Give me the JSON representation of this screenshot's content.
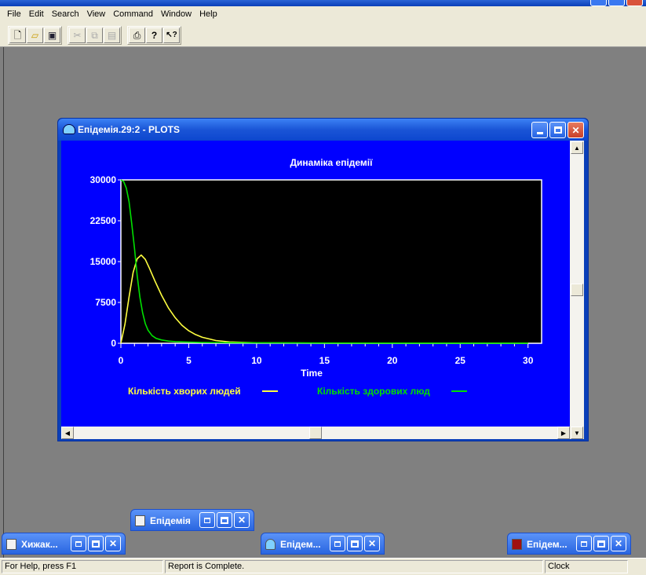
{
  "menubar": {
    "items": [
      "File",
      "Edit",
      "Search",
      "View",
      "Command",
      "Window",
      "Help"
    ]
  },
  "toolbar": {
    "buttons": [
      {
        "name": "new-file-icon",
        "glyph": "🗋"
      },
      {
        "name": "open-folder-icon",
        "glyph": "📂"
      },
      {
        "name": "save-icon",
        "glyph": "💾"
      },
      {
        "name": "cut-icon",
        "glyph": "✂"
      },
      {
        "name": "copy-icon",
        "glyph": "⧉"
      },
      {
        "name": "paste-icon",
        "glyph": "📋"
      },
      {
        "name": "print-icon",
        "glyph": "🖶"
      },
      {
        "name": "help-icon",
        "glyph": "?"
      },
      {
        "name": "context-help-icon",
        "glyph": "↖?"
      }
    ]
  },
  "plot_window": {
    "title": "Епідемія.29:2  -  PLOTS"
  },
  "chart_data": {
    "type": "line",
    "title": "Динаміка епідемії",
    "xlabel": "Time",
    "ylabel": "",
    "xlim": [
      0,
      31
    ],
    "ylim": [
      0,
      30000
    ],
    "xticks": [
      0,
      5,
      10,
      15,
      20,
      25,
      30
    ],
    "yticks": [
      0,
      7500,
      15000,
      22500,
      30000
    ],
    "ytick_labels": [
      "0",
      "7500",
      "15000",
      "22500",
      "30000"
    ],
    "xtick_labels": [
      "0",
      "5",
      "10",
      "15",
      "20",
      "25",
      "30"
    ],
    "legend_placement": "bottom",
    "series": [
      {
        "name": "Кількість хворих людей",
        "color": "#ffff40",
        "x": [
          0,
          0.3,
          0.6,
          0.9,
          1.2,
          1.5,
          1.8,
          2.1,
          2.5,
          3,
          3.5,
          4,
          4.5,
          5,
          5.5,
          6,
          7,
          8,
          10,
          15,
          20,
          25,
          30
        ],
        "y": [
          0,
          3500,
          8500,
          13000,
          15500,
          16200,
          15400,
          13800,
          11500,
          8800,
          6500,
          4700,
          3300,
          2300,
          1600,
          1100,
          500,
          250,
          80,
          10,
          0,
          0,
          0
        ]
      },
      {
        "name": "Кількість здорових люд",
        "color": "#00e000",
        "x": [
          0,
          0.2,
          0.4,
          0.6,
          0.8,
          1.0,
          1.2,
          1.4,
          1.6,
          1.8,
          2.0,
          2.3,
          2.6,
          3,
          3.5,
          4,
          5,
          6,
          8,
          10,
          15,
          20,
          25,
          30
        ],
        "y": [
          30000,
          29700,
          28500,
          26000,
          22000,
          17500,
          12500,
          8500,
          5600,
          3600,
          2400,
          1400,
          900,
          600,
          400,
          300,
          200,
          150,
          100,
          80,
          50,
          30,
          20,
          20
        ]
      }
    ]
  },
  "minimized_windows": [
    {
      "title": "Епідемія",
      "icon": "document-icon"
    },
    {
      "title": "Хижак...",
      "icon": "document-icon"
    },
    {
      "title": "Епідем...",
      "icon": "cloud-icon"
    },
    {
      "title": "Епідем...",
      "icon": "red-document-icon"
    }
  ],
  "statusbar": {
    "help": "For Help, press F1",
    "message": "Report is Complete.",
    "clock": "Clock"
  }
}
